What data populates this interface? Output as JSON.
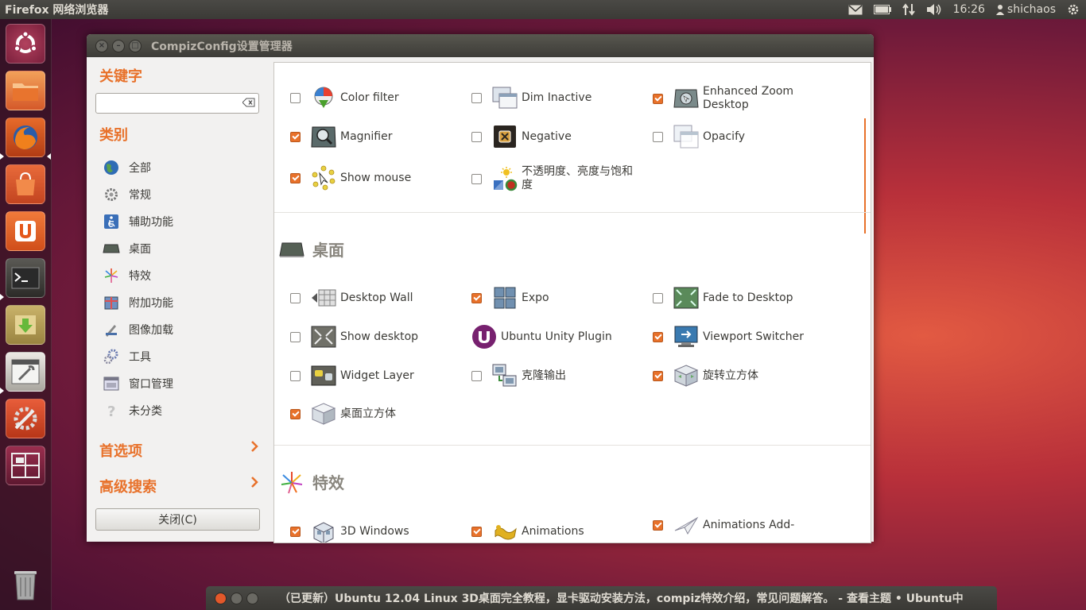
{
  "top_panel": {
    "app_title": "Firefox 网络浏览器",
    "time": "16:26",
    "user": "shichaos",
    "icons": [
      "mail-icon",
      "battery-icon",
      "network-icon",
      "volume-icon",
      "user-icon",
      "gear-icon"
    ]
  },
  "launcher": {
    "items": [
      "ubuntu-dash-icon",
      "files-icon",
      "firefox-icon",
      "software-center-icon",
      "ubuntu-one-icon",
      "terminal-icon",
      "archive-installer-icon",
      "settings-manager-icon",
      "system-settings-icon",
      "workspace-switcher-icon",
      "trash-icon"
    ]
  },
  "window": {
    "title": "CompizConfig设置管理器",
    "sidebar": {
      "keyword_heading": "关键字",
      "search_value": "",
      "category_heading": "类别",
      "categories": [
        {
          "label": "全部",
          "icon": "globe-icon"
        },
        {
          "label": "常规",
          "icon": "gear-icon"
        },
        {
          "label": "辅助功能",
          "icon": "accessibility-icon"
        },
        {
          "label": "桌面",
          "icon": "desktop-icon"
        },
        {
          "label": "特效",
          "icon": "fireworks-icon"
        },
        {
          "label": "附加功能",
          "icon": "extras-icon"
        },
        {
          "label": "图像加载",
          "icon": "image-loading-icon"
        },
        {
          "label": "工具",
          "icon": "tools-icon"
        },
        {
          "label": "窗口管理",
          "icon": "window-management-icon"
        },
        {
          "label": "未分类",
          "icon": "question-icon"
        }
      ],
      "preferences_label": "首选项",
      "advanced_search_label": "高级搜索",
      "close_label": "关闭(C)"
    },
    "sections": [
      {
        "title": "",
        "plugins": [
          {
            "label": "Color filter",
            "checked": false,
            "icon": "color-filter-icon",
            "color": "#4aa02c"
          },
          {
            "label": "Dim Inactive",
            "checked": false,
            "icon": "dim-inactive-icon",
            "color": "#8aa0b8"
          },
          {
            "label": "Enhanced Zoom Desktop",
            "checked": true,
            "icon": "enhanced-zoom-icon",
            "color": "#7a8a8a"
          },
          {
            "label": "Magnifier",
            "checked": true,
            "icon": "magnifier-icon",
            "color": "#5a6a6a"
          },
          {
            "label": "Negative",
            "checked": false,
            "icon": "negative-icon",
            "color": "#2a2520"
          },
          {
            "label": "Opacify",
            "checked": false,
            "icon": "opacify-icon",
            "color": "#b8c4d0"
          },
          {
            "label": "Show mouse",
            "checked": true,
            "icon": "show-mouse-icon",
            "color": "#e8d040"
          },
          {
            "label": "不透明度、亮度与饱和度",
            "checked": false,
            "icon": "opacity-brightness-icon",
            "color": "#f0c020"
          }
        ]
      },
      {
        "title": "桌面",
        "plugins": [
          {
            "label": "Desktop Wall",
            "checked": false,
            "icon": "desktop-wall-icon",
            "color": "#909090"
          },
          {
            "label": "Expo",
            "checked": true,
            "icon": "expo-icon",
            "color": "#7090b0"
          },
          {
            "label": "Fade to Desktop",
            "checked": false,
            "icon": "fade-to-desktop-icon",
            "color": "#5a8a5a"
          },
          {
            "label": "Show desktop",
            "checked": false,
            "icon": "show-desktop-icon",
            "color": "#707068"
          },
          {
            "label": "Ubuntu Unity Plugin",
            "checked": null,
            "icon": "unity-icon",
            "color": "#77216f"
          },
          {
            "label": "Viewport Switcher",
            "checked": true,
            "icon": "viewport-switcher-icon",
            "color": "#3a7ab0"
          },
          {
            "label": "Widget Layer",
            "checked": false,
            "icon": "widget-layer-icon",
            "color": "#606058"
          },
          {
            "label": "克隆输出",
            "checked": false,
            "icon": "clone-output-icon",
            "color": "#8098b0"
          },
          {
            "label": "旋转立方体",
            "checked": true,
            "icon": "rotate-cube-icon",
            "color": "#6aa86a"
          },
          {
            "label": "桌面立方体",
            "checked": true,
            "icon": "desktop-cube-icon",
            "color": "#b0b8c0"
          }
        ]
      },
      {
        "title": "特效",
        "plugins": [
          {
            "label": "3D Windows",
            "checked": true,
            "icon": "3d-windows-icon",
            "color": "#8098b0"
          },
          {
            "label": "Animations",
            "checked": true,
            "icon": "animations-icon",
            "color": "#e0b020"
          },
          {
            "label": "Animations Add-",
            "checked": true,
            "icon": "animations-addon-icon",
            "color": "#a0a8b0"
          }
        ]
      }
    ]
  },
  "taskbar_window": {
    "title": "（已更新）Ubuntu 12.04 Linux 3D桌面完全教程，显卡驱动安装方法，compiz特效介绍，常见问题解答。 - 查看主题 • Ubuntu中"
  }
}
